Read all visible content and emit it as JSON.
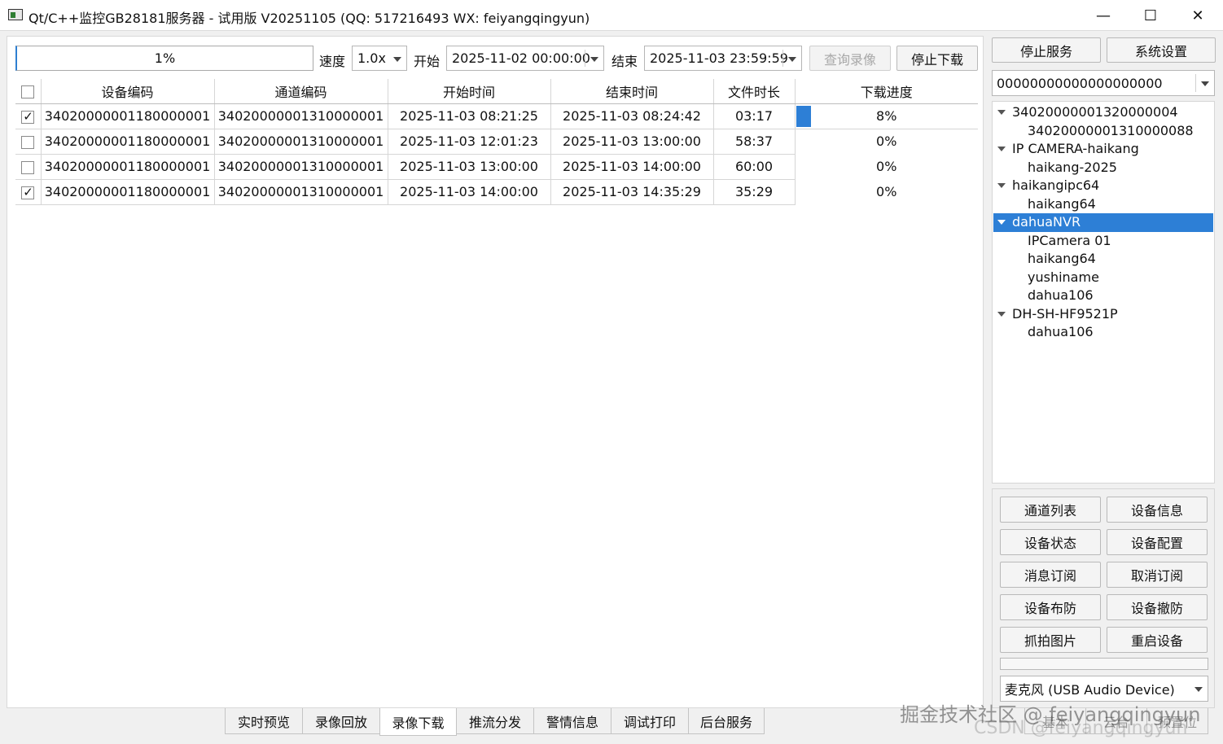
{
  "window": {
    "title": "Qt/C++监控GB28181服务器 - 试用版 V20251105 (QQ: 517216493 WX: feiyangqingyun)",
    "minimize": "—",
    "maximize": "☐",
    "close": "✕"
  },
  "toolbar": {
    "progress_text": "1%",
    "speed_label": "速度",
    "speed_value": "1.0x",
    "start_label": "开始",
    "start_value": "2025-11-02 00:00:00",
    "end_label": "结束",
    "end_value": "2025-11-03 23:59:59",
    "query_button": "查询录像",
    "stop_download_button": "停止下载"
  },
  "table": {
    "headers": [
      "设备编码",
      "通道编码",
      "开始时间",
      "结束时间",
      "文件时长",
      "下载进度"
    ],
    "rows": [
      {
        "checked": true,
        "device": "34020000001180000001",
        "channel": "34020000001310000001",
        "start": "2025-11-03 08:21:25",
        "end": "2025-11-03 08:24:42",
        "duration": "03:17",
        "progress": "8%",
        "progress_value": 0.08
      },
      {
        "checked": false,
        "device": "34020000001180000001",
        "channel": "34020000001310000001",
        "start": "2025-11-03 12:01:23",
        "end": "2025-11-03 13:00:00",
        "duration": "58:37",
        "progress": "0%",
        "progress_value": 0
      },
      {
        "checked": false,
        "device": "34020000001180000001",
        "channel": "34020000001310000001",
        "start": "2025-11-03 13:00:00",
        "end": "2025-11-03 14:00:00",
        "duration": "60:00",
        "progress": "0%",
        "progress_value": 0
      },
      {
        "checked": true,
        "device": "34020000001180000001",
        "channel": "34020000001310000001",
        "start": "2025-11-03 14:00:00",
        "end": "2025-11-03 14:35:29",
        "duration": "35:29",
        "progress": "0%",
        "progress_value": 0
      }
    ]
  },
  "side": {
    "stop_service": "停止服务",
    "system_settings": "系统设置",
    "device_id_value": "00000000000000000000",
    "tree": [
      {
        "label": "34020000001320000004",
        "level": 0,
        "expanded": true,
        "selected": false
      },
      {
        "label": "34020000001310000088",
        "level": 1,
        "selected": false
      },
      {
        "label": "IP CAMERA-haikang",
        "level": 0,
        "expanded": true,
        "selected": false
      },
      {
        "label": "haikang-2025",
        "level": 1,
        "selected": false
      },
      {
        "label": "haikangipc64",
        "level": 0,
        "expanded": true,
        "selected": false
      },
      {
        "label": "haikang64",
        "level": 1,
        "selected": false
      },
      {
        "label": "dahuaNVR",
        "level": 0,
        "expanded": true,
        "selected": true
      },
      {
        "label": "IPCamera 01",
        "level": 1,
        "selected": false
      },
      {
        "label": "haikang64",
        "level": 1,
        "selected": false
      },
      {
        "label": "yushiname",
        "level": 1,
        "selected": false
      },
      {
        "label": "dahua106",
        "level": 1,
        "selected": false
      },
      {
        "label": "DH-SH-HF9521P",
        "level": 0,
        "expanded": true,
        "selected": false
      },
      {
        "label": "dahua106",
        "level": 1,
        "selected": false
      }
    ],
    "buttons": [
      [
        "通道列表",
        "设备信息"
      ],
      [
        "设备状态",
        "设备配置"
      ],
      [
        "消息订阅",
        "取消订阅"
      ],
      [
        "设备布防",
        "设备撤防"
      ],
      [
        "抓拍图片",
        "重启设备"
      ]
    ],
    "audio_device": "麦克风 (USB Audio Device)"
  },
  "tabs": [
    "实时预览",
    "录像回放",
    "录像下载",
    "推流分发",
    "警情信息",
    "调试打印",
    "后台服务"
  ],
  "active_tab": "录像下载",
  "right_tabs": [
    "基本",
    "云台",
    "预置位"
  ],
  "watermark": "掘金技术社区 @ feiyangqingyun",
  "watermark2": "CSDN @feiyangqingyun",
  "colors": {
    "accent": "#2d7fd6"
  }
}
